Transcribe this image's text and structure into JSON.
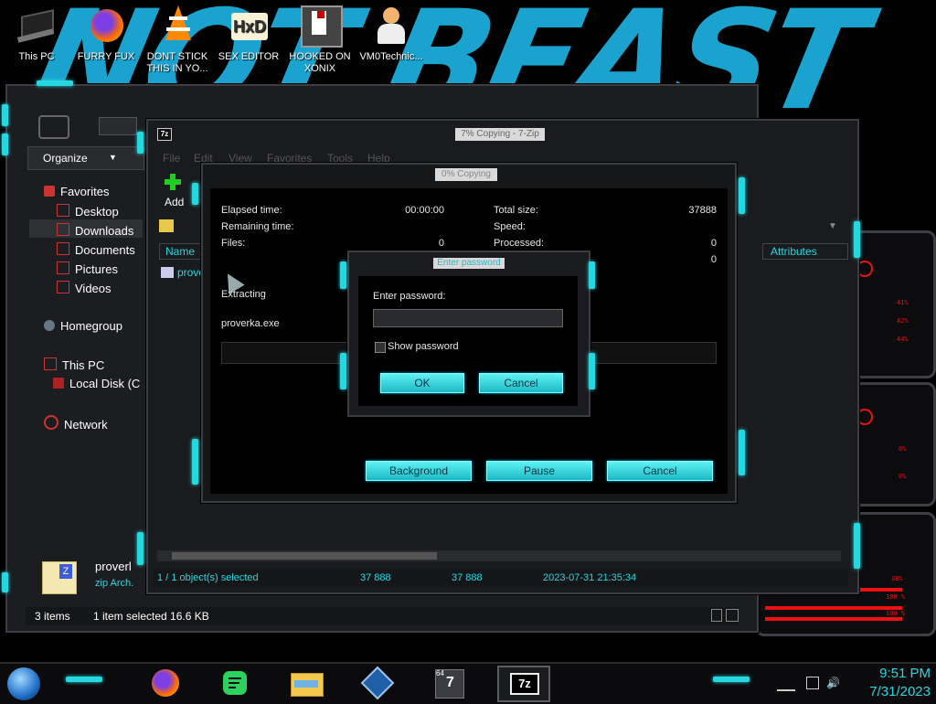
{
  "desktop": {
    "wallpaper_text": "NOT BEAST",
    "icons": [
      {
        "label": "This PC",
        "icon": "laptop-icon"
      },
      {
        "label": "FURRY FUX",
        "icon": "firefox-icon"
      },
      {
        "label": "DONT STICK THIS IN YO...",
        "icon": "vlc-cone-icon"
      },
      {
        "label": "SEX EDITOR",
        "icon": "hxd-editor-icon"
      },
      {
        "label": "HOOKED ON XONIX",
        "icon": "game-icon"
      },
      {
        "label": "VM0Technic...",
        "icon": "doctor-avatar-icon"
      }
    ]
  },
  "explorer": {
    "organize_label": "Organize",
    "organize_arrow": "▼",
    "nav": {
      "favorites": "Favorites",
      "desktop": "Desktop",
      "downloads": "Downloads",
      "documents": "Documents",
      "pictures": "Pictures",
      "videos": "Videos",
      "homegroup": "Homegroup",
      "this_pc": "This PC",
      "local_disk": "Local Disk (C",
      "network": "Network"
    },
    "details": {
      "name": "proverl",
      "type": "zip Arch."
    },
    "status": {
      "items": "3 items",
      "selected": "1 item selected  16.6 KB"
    }
  },
  "sevenzip_fm": {
    "title": "7% Copying - 7-Zip",
    "menu": [
      "File",
      "Edit",
      "View",
      "Favorites",
      "Tools",
      "Help"
    ],
    "toolbar": {
      "add_label": "Add"
    },
    "columns": {
      "name": "Name",
      "attributes": "Attributes"
    },
    "file_row": "prove",
    "status": {
      "selected": "1 / 1 object(s) selected",
      "size1": "37 888",
      "size2": "37 888",
      "date": "2023-07-31 21:35:34"
    }
  },
  "progress": {
    "title": "0% Copying",
    "left": {
      "elapsed_label": "Elapsed time:",
      "elapsed_value": "00:00:00",
      "remaining_label": "Remaining time:",
      "files_label": "Files:",
      "files_value": "0"
    },
    "right": {
      "total_label": "Total size:",
      "total_value": "37888",
      "speed_label": "Speed:",
      "processed_label": "Processed:",
      "processed_value": "0",
      "extra_value": "0"
    },
    "operation": "Extracting",
    "filename": "proverka.exe",
    "buttons": {
      "background": "Background",
      "pause": "Pause",
      "cancel": "Cancel"
    }
  },
  "password_dialog": {
    "title": "Enter password",
    "prompt": "Enter password:",
    "input_value": "",
    "show_password_label": "Show password",
    "show_password_checked": false,
    "ok": "OK",
    "cancel": "Cancel"
  },
  "side_panel": {
    "readouts": [
      "41%",
      "42%",
      "44%",
      "0%",
      "0%",
      "38%",
      "100 %",
      "100 %"
    ]
  },
  "taskbar": {
    "time": "9:51 PM",
    "date": "7/31/2023",
    "pinned": [
      "firefox-icon",
      "spotify-icon",
      "file-explorer-icon",
      "virtualbox-icon",
      "7zip-64-icon",
      "7zip-icon"
    ]
  },
  "colors": {
    "accent": "#27d7e0",
    "frame": "#1c1d20",
    "warning_red": "#e11111",
    "wallpaper_blue": "#1aa3cf"
  }
}
